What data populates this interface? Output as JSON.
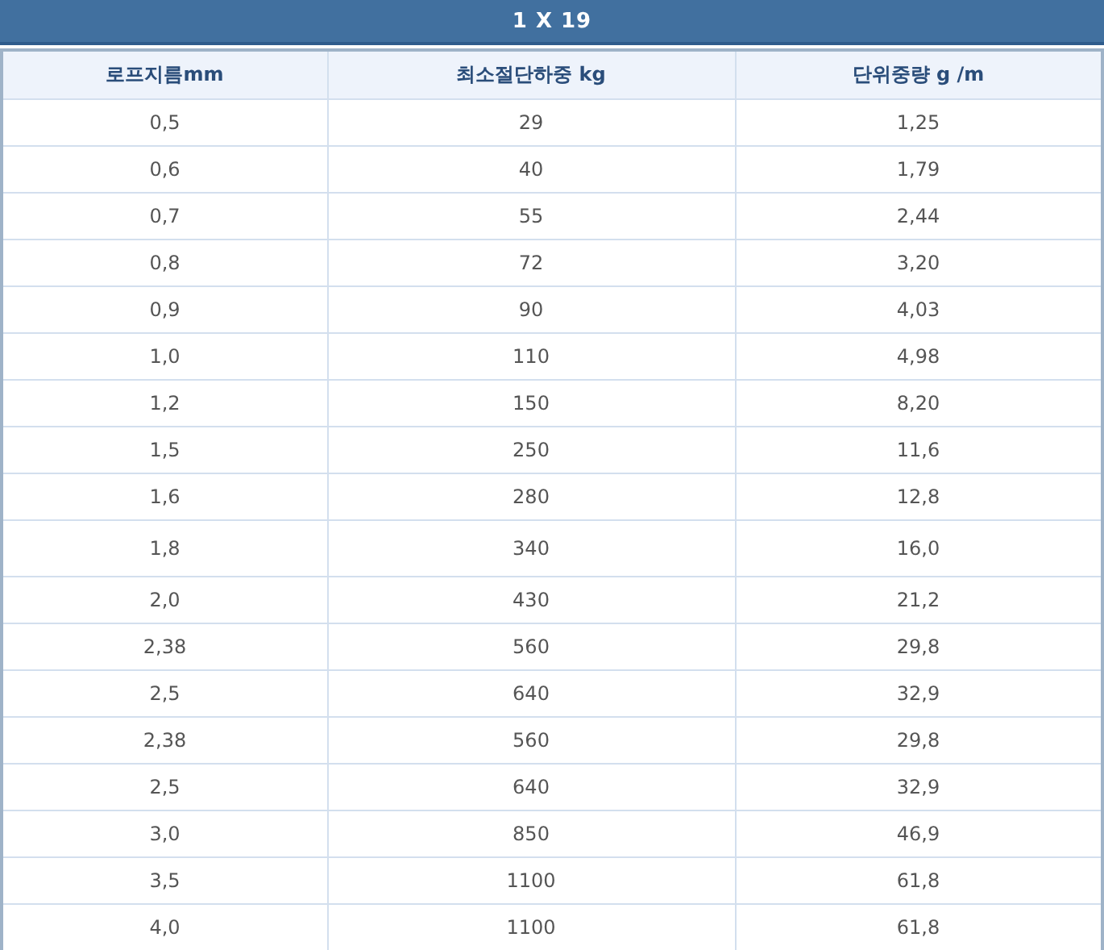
{
  "title": "1 X 19",
  "table": {
    "columns": [
      "로프지름mm",
      "최소절단하중 kg",
      "단위중량 g /m"
    ],
    "rows": [
      [
        "0,5",
        "29",
        "1,25"
      ],
      [
        "0,6",
        "40",
        "1,79"
      ],
      [
        "0,7",
        "55",
        "2,44"
      ],
      [
        "0,8",
        "72",
        "3,20"
      ],
      [
        "0,9",
        "90",
        "4,03"
      ],
      [
        "1,0",
        "110",
        "4,98"
      ],
      [
        "1,2",
        "150",
        "8,20"
      ],
      [
        "1,5",
        "250",
        "11,6"
      ],
      [
        "1,6",
        "280",
        "12,8"
      ],
      [
        "1,8",
        "340",
        "16,0"
      ],
      [
        "2,0",
        "430",
        "21,2"
      ],
      [
        "2,38",
        "560",
        "29,8"
      ],
      [
        "2,5",
        "640",
        "32,9"
      ],
      [
        "2,38",
        "560",
        "29,8"
      ],
      [
        "2,5",
        "640",
        "32,9"
      ],
      [
        "3,0",
        "850",
        "46,9"
      ],
      [
        "3,5",
        "1100",
        "61,8"
      ],
      [
        "4,0",
        "1100",
        "61,8"
      ]
    ]
  }
}
